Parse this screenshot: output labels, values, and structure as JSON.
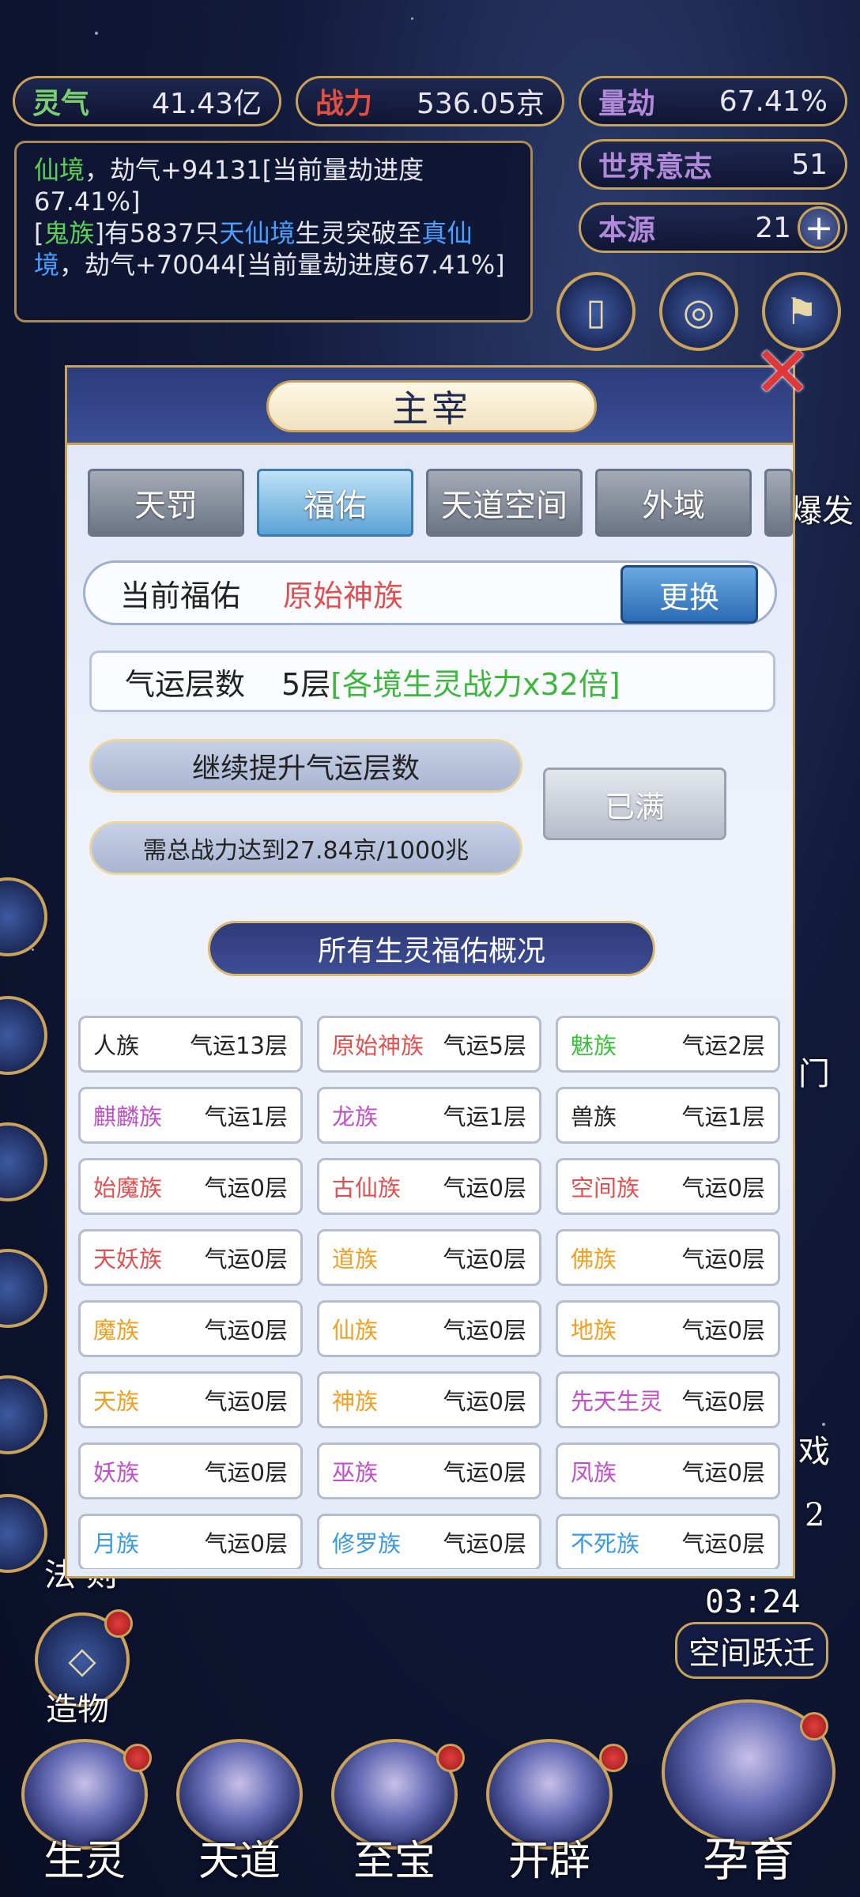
{
  "top_stats": {
    "lingqi": {
      "label": "灵气",
      "value": "41.43亿"
    },
    "zhanli": {
      "label": "战力",
      "value": "536.05京"
    },
    "liangjie": {
      "label": "量劫",
      "value": "67.41%"
    },
    "shijie": {
      "label": "世界意志",
      "value": "51"
    },
    "benyuan": {
      "label": "本源",
      "value": "21"
    }
  },
  "log": {
    "line1_a": "仙境",
    "line1_b": "，劫气+94131[当前量劫进度67.41%]",
    "line2_a": "[",
    "line2_b": "鬼族",
    "line2_c": "]有5837只",
    "line2_d": "天仙境",
    "line2_e": "生灵突破至",
    "line2_f": "真仙境",
    "line2_g": "，劫气+70044[当前量劫进度67.41%]"
  },
  "side": {
    "left_label_1": "法 则",
    "left_label_2": "造物",
    "right_timer": "03:24",
    "right_label": "空间跃迁",
    "right_partial_1": "爆发",
    "right_partial_2": "门",
    "right_partial_3": "戏",
    "right_partial_4": "2"
  },
  "bottom_nav": [
    {
      "label": "生灵"
    },
    {
      "label": "天道"
    },
    {
      "label": "至宝"
    },
    {
      "label": "开辟"
    },
    {
      "label": "孕育"
    }
  ],
  "modal": {
    "title": "主宰",
    "tabs": [
      "天罚",
      "福佑",
      "天道空间",
      "外域"
    ],
    "active_tab": "福佑",
    "current_label": "当前福佑",
    "current_value": "原始神族",
    "swap_label": "更换",
    "luck_label": "气运层数",
    "luck_level": "5层",
    "luck_bonus": "[各境生灵战力x32倍]",
    "upgrade_label": "继续提升气运层数",
    "requirement": "需总战力达到27.84京/1000兆",
    "full_label": "已满",
    "overview_title": "所有生灵福佑概况",
    "colors": {
      "red": "#e05050",
      "green": "#3cc03c",
      "purple": "#c050c8",
      "orange": "#f0a020",
      "blue": "#3a9ae0",
      "black": "#222222"
    },
    "races": [
      {
        "name": "人族",
        "level": "气运13层",
        "color": "#222222"
      },
      {
        "name": "原始神族",
        "level": "气运5层",
        "color": "#e05050"
      },
      {
        "name": "魅族",
        "level": "气运2层",
        "color": "#3cc03c"
      },
      {
        "name": "麒麟族",
        "level": "气运1层",
        "color": "#c050c8"
      },
      {
        "name": "龙族",
        "level": "气运1层",
        "color": "#c050c8"
      },
      {
        "name": "兽族",
        "level": "气运1层",
        "color": "#222222"
      },
      {
        "name": "始魔族",
        "level": "气运0层",
        "color": "#e05050"
      },
      {
        "name": "古仙族",
        "level": "气运0层",
        "color": "#e05050"
      },
      {
        "name": "空间族",
        "level": "气运0层",
        "color": "#e05050"
      },
      {
        "name": "天妖族",
        "level": "气运0层",
        "color": "#e05050"
      },
      {
        "name": "道族",
        "level": "气运0层",
        "color": "#f0a020"
      },
      {
        "name": "佛族",
        "level": "气运0层",
        "color": "#f0a020"
      },
      {
        "name": "魔族",
        "level": "气运0层",
        "color": "#f0a020"
      },
      {
        "name": "仙族",
        "level": "气运0层",
        "color": "#f0a020"
      },
      {
        "name": "地族",
        "level": "气运0层",
        "color": "#f0a020"
      },
      {
        "name": "天族",
        "level": "气运0层",
        "color": "#f0a020"
      },
      {
        "name": "神族",
        "level": "气运0层",
        "color": "#f0a020"
      },
      {
        "name": "先天生灵",
        "level": "气运0层",
        "color": "#c050c8"
      },
      {
        "name": "妖族",
        "level": "气运0层",
        "color": "#c050c8"
      },
      {
        "name": "巫族",
        "level": "气运0层",
        "color": "#c050c8"
      },
      {
        "name": "凤族",
        "level": "气运0层",
        "color": "#c050c8"
      },
      {
        "name": "月族",
        "level": "气运0层",
        "color": "#3a9ae0"
      },
      {
        "name": "修罗族",
        "level": "气运0层",
        "color": "#3a9ae0"
      },
      {
        "name": "不死族",
        "level": "气运0层",
        "color": "#3a9ae0"
      }
    ]
  }
}
